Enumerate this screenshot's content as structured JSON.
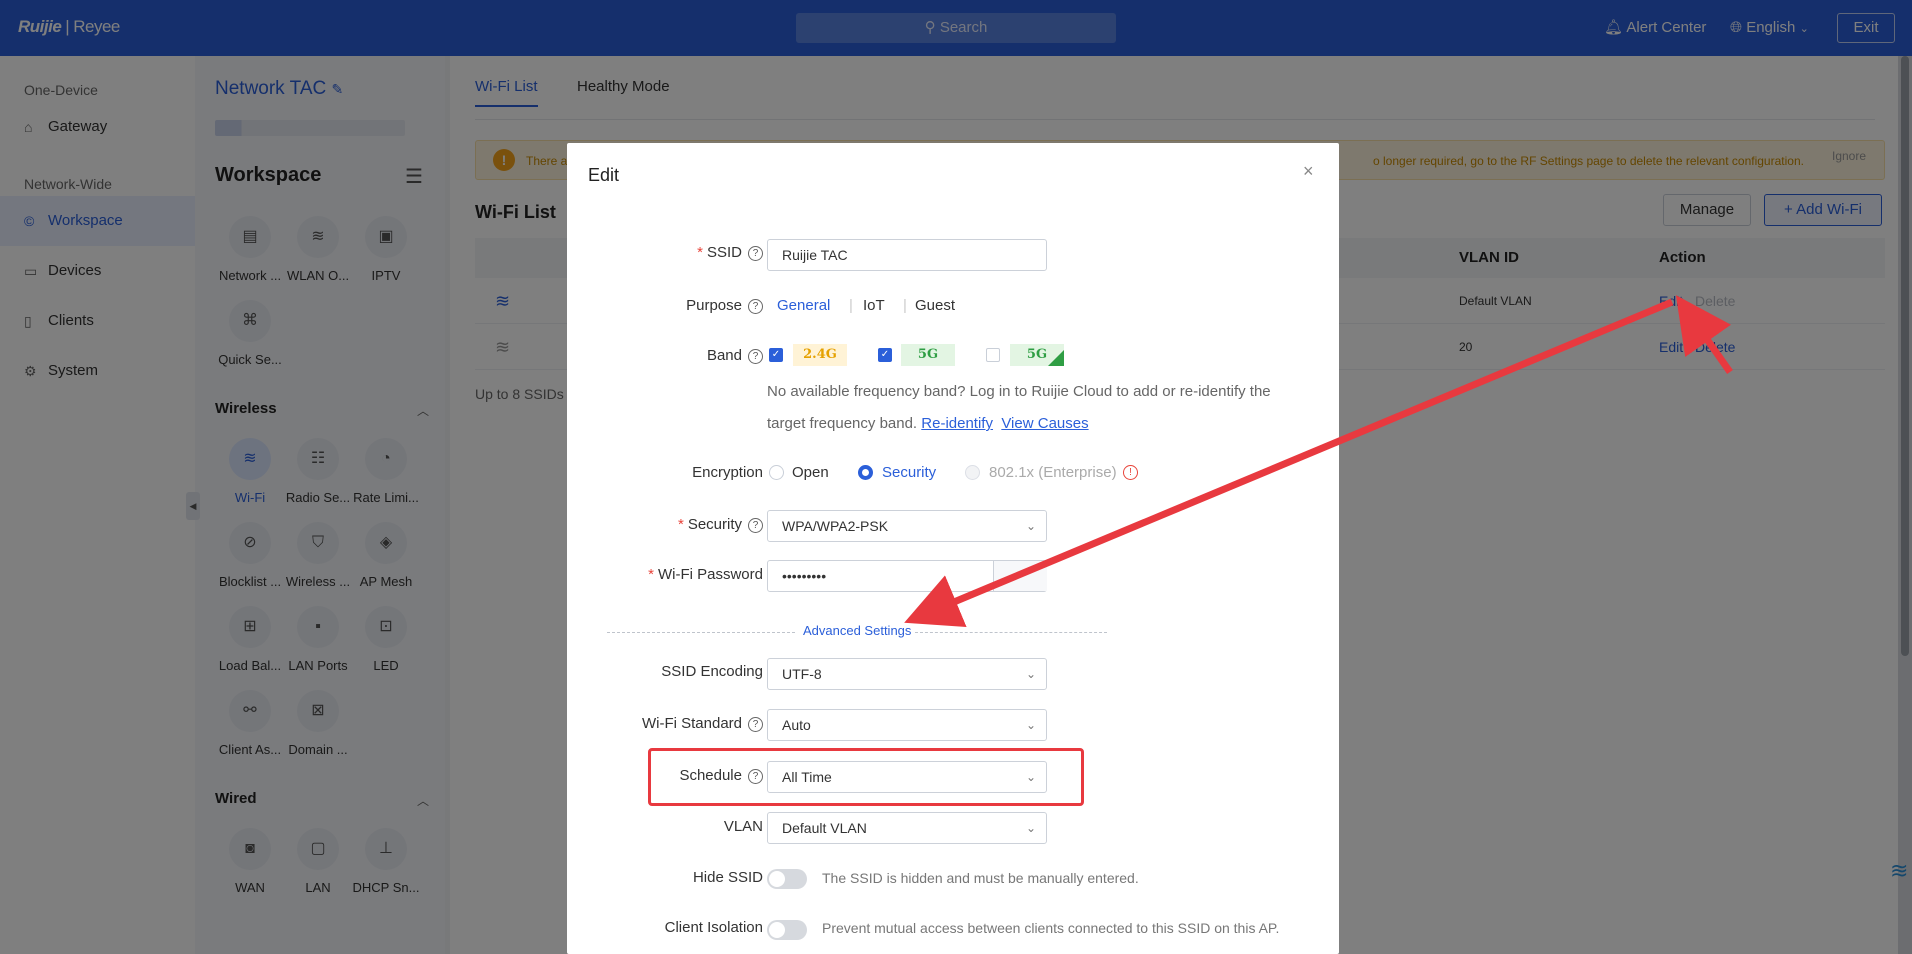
{
  "topbar": {
    "logo_brand": "Ruijie",
    "logo_sep": "|",
    "logo_product": "Reyee",
    "search_label": "Search",
    "alert_center": "Alert Center",
    "language": "English",
    "exit": "Exit"
  },
  "leftnav": {
    "group1": "One-Device",
    "gateway": "Gateway",
    "group2": "Network-Wide",
    "workspace": "Workspace",
    "devices": "Devices",
    "clients": "Clients",
    "system": "System"
  },
  "panel": {
    "project_title": "Network TAC",
    "workspace_title": "Workspace",
    "tiles_top": [
      "Network ...",
      "WLAN O...",
      "IPTV",
      "Quick Se..."
    ],
    "wireless_title": "Wireless",
    "wireless_tiles": [
      "Wi-Fi",
      "Radio Se...",
      "Rate Limi...",
      "Blocklist ...",
      "Wireless ...",
      "AP Mesh",
      "Load Bal...",
      "LAN Ports",
      "LED",
      "Client As...",
      "Domain ..."
    ],
    "wired_title": "Wired",
    "wired_tiles": [
      "WAN",
      "LAN",
      "DHCP Sn..."
    ]
  },
  "main": {
    "tabs": [
      "Wi-Fi List",
      "Healthy Mode"
    ],
    "alert_left": "There a",
    "alert_right": "o longer required, go to the RF Settings page to delete the relevant configuration.",
    "alert_ignore": "Ignore",
    "list_title": "Wi-Fi List",
    "manage": "Manage",
    "add_wifi": "+ Add Wi-Fi",
    "col_vlan": "VLAN ID",
    "col_action": "Action",
    "rows": [
      {
        "vlan": "Default VLAN",
        "edit": "Edit",
        "delete": "Delete"
      },
      {
        "vlan": "20",
        "edit": "Edit",
        "delete": "Delete"
      }
    ],
    "footer_note": "Up to 8 SSIDs"
  },
  "modal": {
    "title": "Edit",
    "close": "×",
    "ssid_label": "SSID",
    "ssid_value": "Ruijie TAC",
    "purpose_label": "Purpose",
    "purpose_options": [
      "General",
      "IoT",
      "Guest"
    ],
    "band_label": "Band",
    "band_24": "2.4G",
    "band_5": "5G",
    "band_5b": "5G",
    "band_note_1": "No available frequency band? Log in to Ruijie Cloud to add or re-identify the",
    "band_note_2": "target frequency band.",
    "reidentify": "Re-identify",
    "view_causes": "View Causes",
    "encryption_label": "Encryption",
    "enc_open": "Open",
    "enc_security": "Security",
    "enc_enterprise": "802.1x (Enterprise)",
    "security_label": "Security",
    "security_value": "WPA/WPA2-PSK",
    "password_label": "Wi-Fi Password",
    "password_value": "•••••••••",
    "advanced": "Advanced Settings",
    "encoding_label": "SSID Encoding",
    "encoding_value": "UTF-8",
    "standard_label": "Wi-Fi Standard",
    "standard_value": "Auto",
    "schedule_label": "Schedule",
    "schedule_value": "All Time",
    "vlan_label": "VLAN",
    "vlan_value": "Default VLAN",
    "hide_label": "Hide SSID",
    "hide_hint": "The SSID is hidden and must be manually entered.",
    "isolation_label": "Client Isolation",
    "isolation_hint": "Prevent mutual access between clients connected to this SSID on this AP."
  },
  "colors": {
    "primary": "#2b5fd9",
    "annotation_red": "#e8393f",
    "band24_bg": "#fff3d6",
    "band5_bg": "#e3f5e3"
  }
}
